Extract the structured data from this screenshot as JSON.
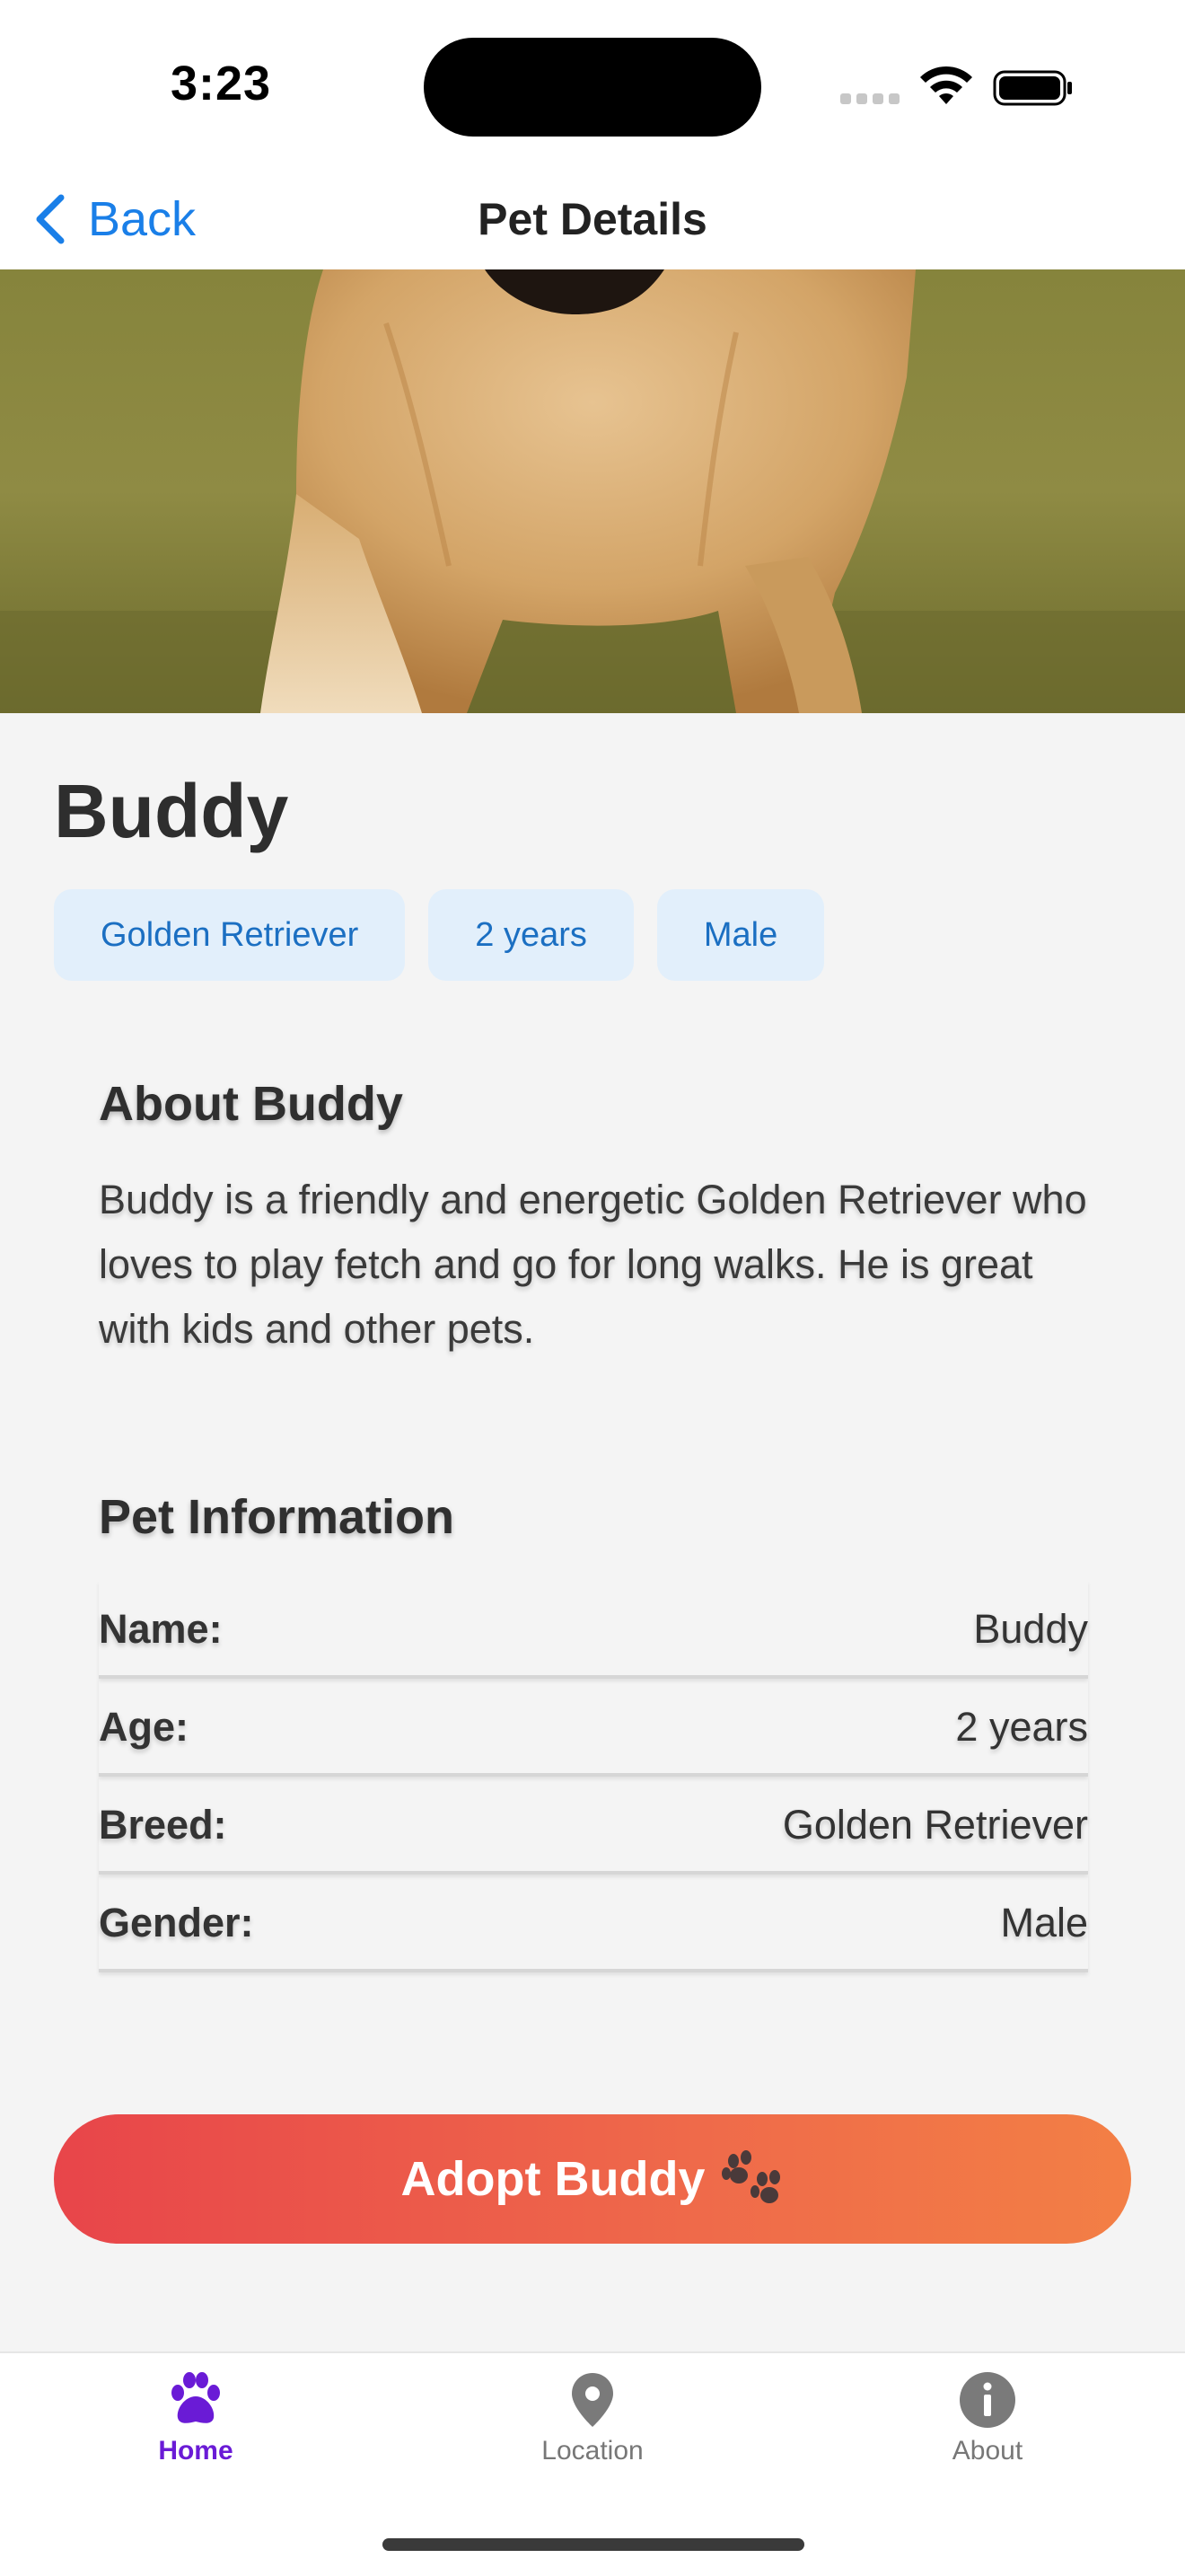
{
  "status_bar": {
    "time": "3:23"
  },
  "nav": {
    "back_label": "Back",
    "title": "Pet Details"
  },
  "hero": {
    "image": "golden-retriever-photo"
  },
  "pet": {
    "name": "Buddy",
    "tags": [
      "Golden Retriever",
      "2 years",
      "Male"
    ]
  },
  "about": {
    "title": "About Buddy",
    "text": "Buddy is a friendly and energetic Golden Retriever who loves to play fetch and go for long walks. He is great with kids and other pets."
  },
  "info": {
    "title": "Pet Information",
    "rows": [
      {
        "label": "Name:",
        "value": "Buddy"
      },
      {
        "label": "Age:",
        "value": "2 years"
      },
      {
        "label": "Breed:",
        "value": "Golden Retriever"
      },
      {
        "label": "Gender:",
        "value": "Male"
      }
    ]
  },
  "adopt": {
    "label": "Adopt Buddy",
    "icon": "paw-icon"
  },
  "tabs": [
    {
      "label": "Home",
      "icon": "paw-icon",
      "active": true
    },
    {
      "label": "Location",
      "icon": "location-pin-icon",
      "active": false
    },
    {
      "label": "About",
      "icon": "info-icon",
      "active": false
    }
  ],
  "colors": {
    "accent": "#1a7fe8",
    "tab_active": "#6a1bd6",
    "tag_bg": "#e2effb",
    "tag_text": "#1b6fc2",
    "adopt_gradient_start": "#e8454a",
    "adopt_gradient_end": "#f37f45"
  }
}
